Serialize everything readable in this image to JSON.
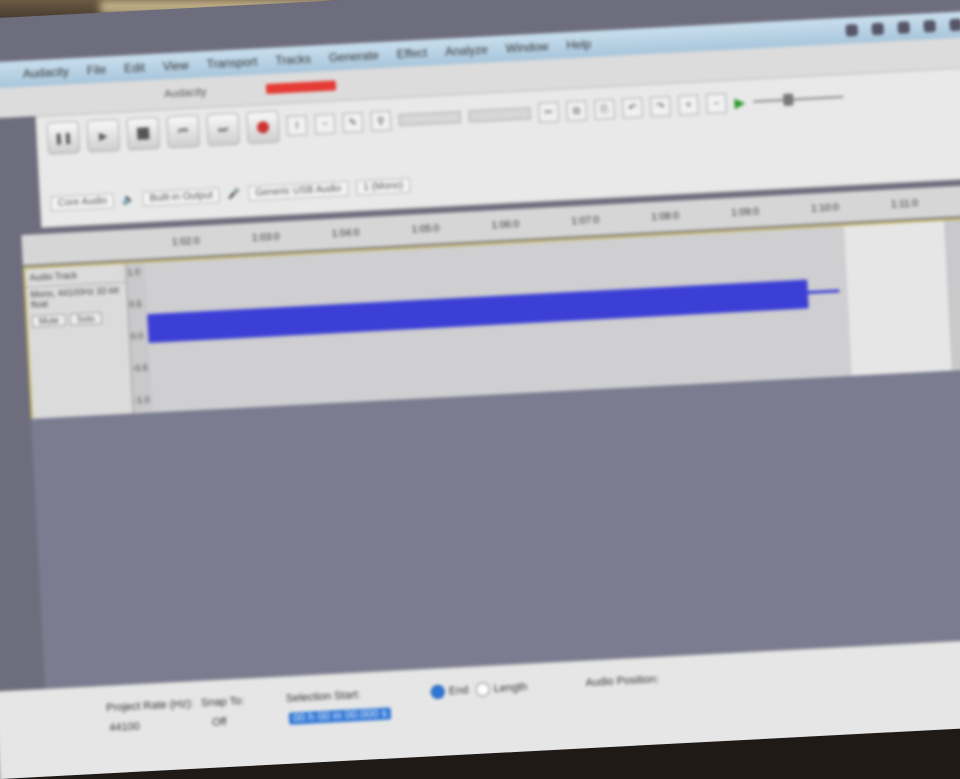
{
  "menubar": {
    "items": [
      "Audacity",
      "File",
      "Edit",
      "View",
      "Transport",
      "Tracks",
      "Generate",
      "Effect",
      "Analyze",
      "Window",
      "Help"
    ]
  },
  "window": {
    "title": "Audacity"
  },
  "colors": {
    "waveform": "#3c3fd6",
    "record": "#e53b34",
    "selection": "#2d75d6",
    "track_border": "#c9b964"
  },
  "device": {
    "host": "Core Audio",
    "output": "Built-in Output",
    "input": "Generic USB Audio",
    "channels": "1 (Mono)"
  },
  "ruler": {
    "labels": [
      "1:02:0",
      "1:03:0",
      "1:04:0",
      "1:05:0",
      "1:06:0",
      "1:07:0",
      "1:08:0",
      "1:09:0",
      "1:10:0",
      "1:11:0"
    ]
  },
  "track": {
    "name": "Audio Track",
    "info": "Mono, 44100Hz 32-bit float",
    "mute": "Mute",
    "solo": "Solo",
    "scale": [
      "1.0",
      "0.5",
      "0.0",
      "-0.5",
      "-1.0"
    ]
  },
  "selection_bar": {
    "project_rate_label": "Project Rate (Hz):",
    "project_rate": "44100",
    "snap_label": "Snap To:",
    "snap_value": "Off",
    "selection_start_label": "Selection Start:",
    "selection_start": "00 h 00 m 00.000 s",
    "end_label": "End",
    "length_label": "Length",
    "audio_position_label": "Audio Position:"
  }
}
